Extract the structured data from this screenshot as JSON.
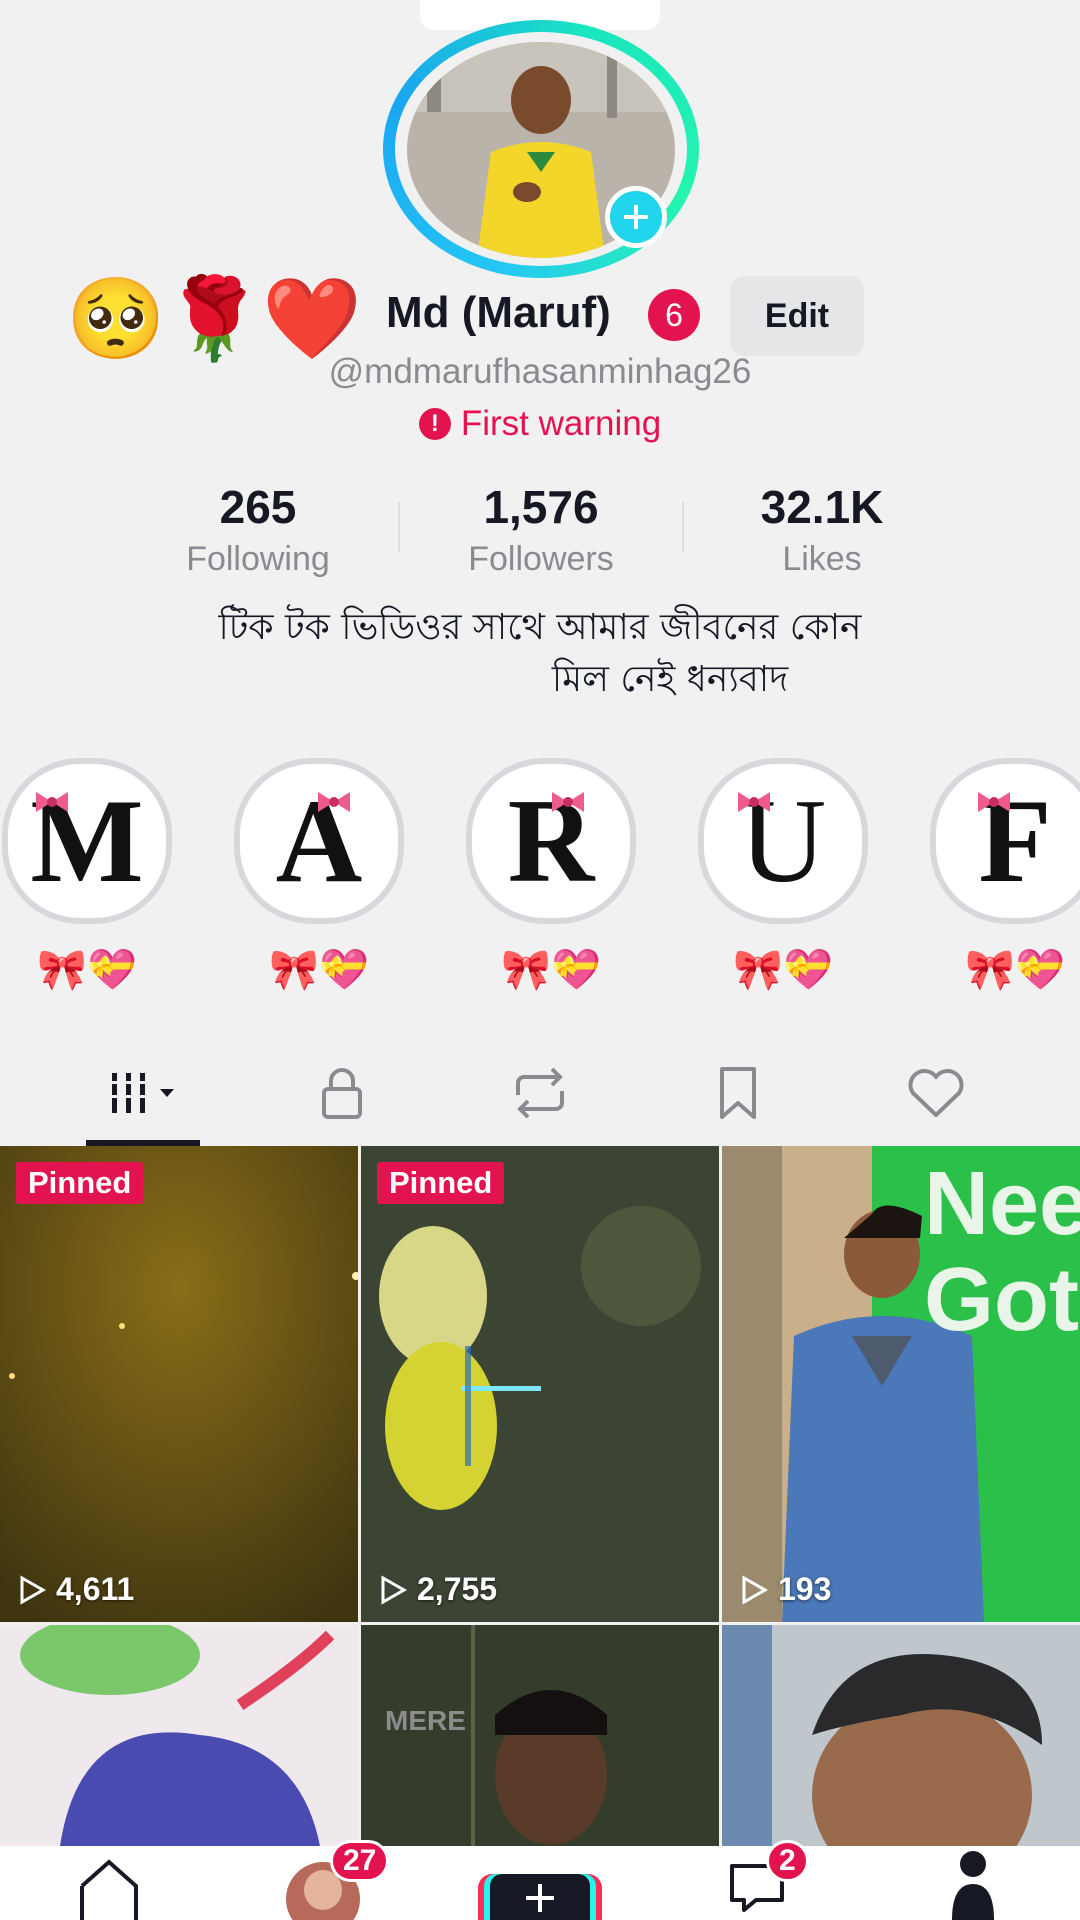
{
  "profile": {
    "emojis": [
      "🥺",
      "🌹",
      "❤️"
    ],
    "display_name": "Md (Maruf)",
    "name_badge": "6",
    "edit_label": "Edit",
    "handle": "@mdmarufhasanminhag26",
    "warning": "First warning"
  },
  "stats": [
    {
      "value": "265",
      "label": "Following"
    },
    {
      "value": "1,576",
      "label": "Followers"
    },
    {
      "value": "32.1K",
      "label": "Likes"
    }
  ],
  "bio": {
    "line1": "টিক টক ভিডিওর সাথে আমার জীবনের কোন",
    "line2": "মিল নেই ধন্যবাদ"
  },
  "highlights": [
    {
      "letter": "M",
      "caption": "🎀💝"
    },
    {
      "letter": "A",
      "caption": "🎀💝"
    },
    {
      "letter": "R",
      "caption": "🎀💝"
    },
    {
      "letter": "U",
      "caption": "🎀💝"
    },
    {
      "letter": "F",
      "caption": "🎀💝"
    }
  ],
  "tabs": [
    {
      "icon": "grid-videos-icon",
      "active": true
    },
    {
      "icon": "lock-icon"
    },
    {
      "icon": "repost-icon"
    },
    {
      "icon": "bookmark-icon"
    },
    {
      "icon": "heart-icon"
    }
  ],
  "videos": [
    {
      "pinned_label": "Pinned",
      "views": "4,611"
    },
    {
      "pinned_label": "Pinned",
      "views": "2,755"
    },
    {
      "pinned_label": "",
      "views": "193",
      "overlay_text": "Nee Got"
    },
    {
      "views": ""
    },
    {
      "views": "",
      "overlay_text": "MERE"
    },
    {
      "views": ""
    }
  ],
  "bottom_nav": {
    "friends_badge": "27",
    "inbox_badge": "2",
    "icons": [
      "home-icon",
      "friends-avatar",
      "create-icon",
      "inbox-icon",
      "profile-icon"
    ]
  },
  "colors": {
    "accent": "#e3134f",
    "cyan": "#20d5ec",
    "text_secondary": "#8a8b91",
    "background": "#f1f1f2"
  }
}
